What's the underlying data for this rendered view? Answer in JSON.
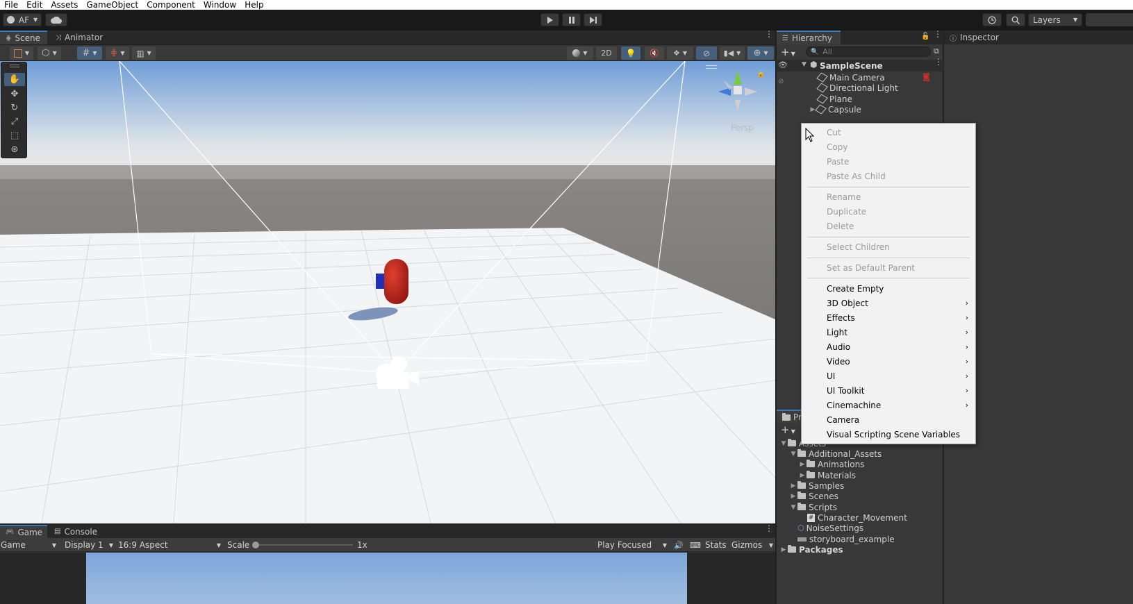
{
  "menubar": {
    "items": [
      "File",
      "Edit",
      "Assets",
      "GameObject",
      "Component",
      "Window",
      "Help"
    ]
  },
  "toolbar": {
    "account_label": "AF",
    "layers_label": "Layers",
    "icons": [
      "account-icon",
      "cloud-icon",
      "play-icon",
      "pause-icon",
      "step-icon",
      "history-icon",
      "search-icon"
    ]
  },
  "scene_panel": {
    "tabs": [
      "Scene",
      "Animator"
    ],
    "toggle_2d": "2D",
    "gizmo_label": "Persp"
  },
  "hierarchy": {
    "tab_label": "Hierarchy",
    "search_placeholder": "All",
    "scene_name": "SampleScene",
    "objects": [
      "Main Camera",
      "Directional Light",
      "Plane",
      "Capsule"
    ]
  },
  "inspector": {
    "tab_label": "Inspector"
  },
  "project": {
    "tab_label": "Pr",
    "tree": [
      {
        "label": "Assets",
        "depth": 0,
        "expanded": true
      },
      {
        "label": "Additional_Assets",
        "depth": 1,
        "expanded": true
      },
      {
        "label": "Animations",
        "depth": 2,
        "expanded": false
      },
      {
        "label": "Materials",
        "depth": 2,
        "expanded": false
      },
      {
        "label": "Samples",
        "depth": 1,
        "expanded": false
      },
      {
        "label": "Scenes",
        "depth": 1,
        "expanded": false
      },
      {
        "label": "Scripts",
        "depth": 1,
        "expanded": true
      },
      {
        "label": "Character_Movement",
        "depth": 2
      },
      {
        "label": "NoiseSettings",
        "depth": 1
      },
      {
        "label": "storyboard_example",
        "depth": 1
      },
      {
        "label": "Packages",
        "depth": 0,
        "expanded": false
      }
    ]
  },
  "context_menu": {
    "items": [
      {
        "label": "Cut",
        "enabled": false
      },
      {
        "label": "Copy",
        "enabled": false
      },
      {
        "label": "Paste",
        "enabled": false
      },
      {
        "label": "Paste As Child",
        "enabled": false
      },
      {
        "label": "Rename",
        "enabled": false
      },
      {
        "label": "Duplicate",
        "enabled": false
      },
      {
        "label": "Delete",
        "enabled": false
      },
      {
        "label": "Select Children",
        "enabled": false
      },
      {
        "label": "Set as Default Parent",
        "enabled": false
      },
      {
        "label": "Create Empty",
        "enabled": true
      },
      {
        "label": "3D Object",
        "enabled": true,
        "submenu": true
      },
      {
        "label": "Effects",
        "enabled": true,
        "submenu": true
      },
      {
        "label": "Light",
        "enabled": true,
        "submenu": true
      },
      {
        "label": "Audio",
        "enabled": true,
        "submenu": true
      },
      {
        "label": "Video",
        "enabled": true,
        "submenu": true
      },
      {
        "label": "UI",
        "enabled": true,
        "submenu": true
      },
      {
        "label": "UI Toolkit",
        "enabled": true,
        "submenu": true
      },
      {
        "label": "Cinemachine",
        "enabled": true,
        "submenu": true
      },
      {
        "label": "Camera",
        "enabled": true
      },
      {
        "label": "Visual Scripting Scene Variables",
        "enabled": true
      }
    ]
  },
  "game_panel": {
    "tabs": [
      "Game",
      "Console"
    ],
    "view_select": "Game",
    "display_select": "Display 1",
    "aspect_select": "16:9 Aspect",
    "scale_label": "Scale",
    "scale_value": "1x",
    "play_mode": "Play Focused",
    "stats_label": "Stats",
    "gizmos_label": "Gizmos"
  },
  "colors": {
    "accent": "#3a79bb",
    "toggle_on": "#46607c",
    "panel_bg": "#383838",
    "capsule": "#c4221c"
  }
}
